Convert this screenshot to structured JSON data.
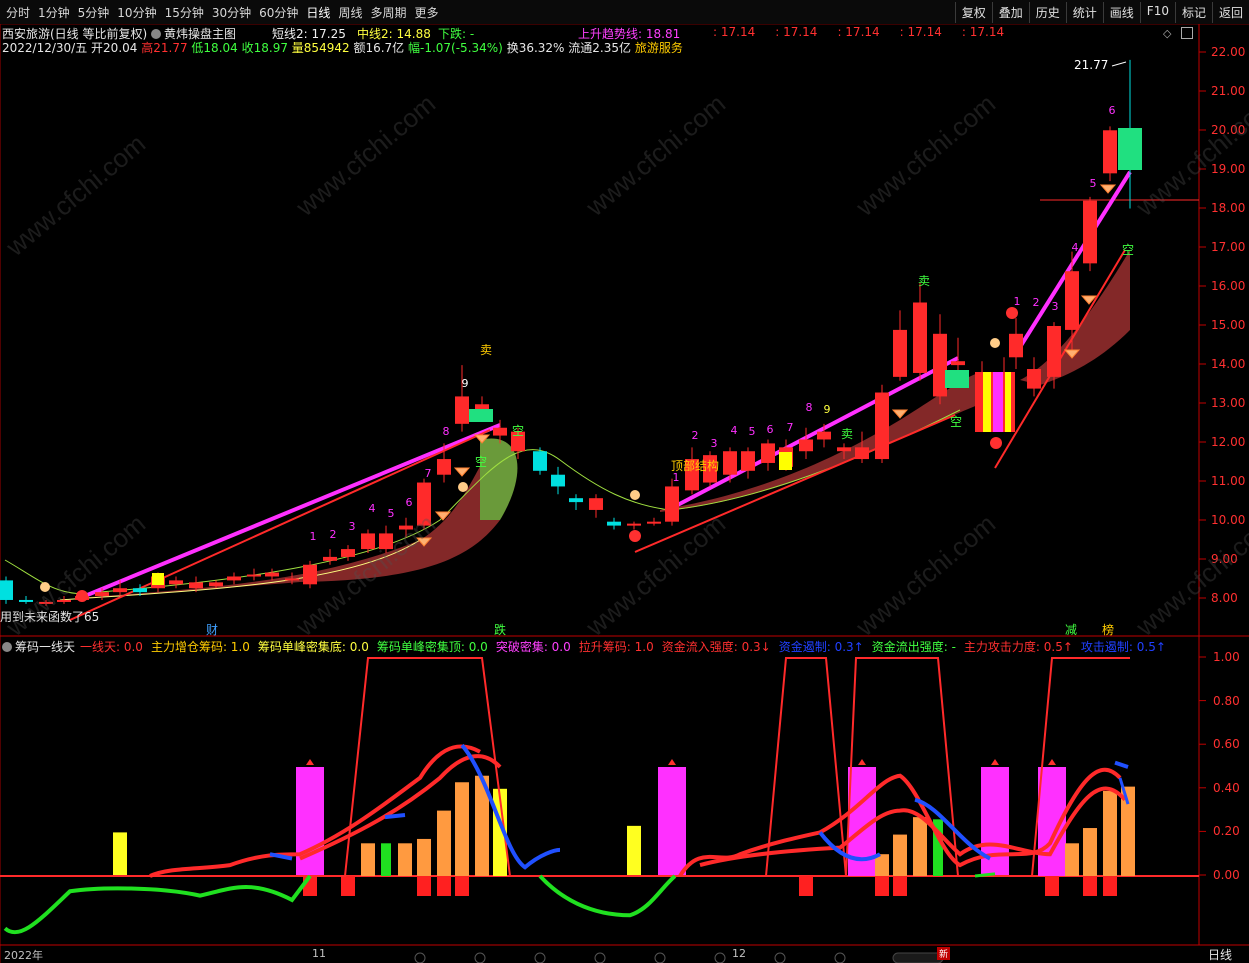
{
  "toolbar": {
    "periods": [
      "分时",
      "1分钟",
      "5分钟",
      "10分钟",
      "15分钟",
      "30分钟",
      "60分钟",
      "日线",
      "周线",
      "多周期",
      "更多"
    ],
    "active": "日线",
    "right_buttons": [
      "复权",
      "叠加",
      "历史",
      "统计",
      "画线",
      "F10",
      "标记",
      "返回"
    ]
  },
  "header": {
    "stock": "西安旅游(日线 等比前复权)",
    "formula": "黄炜操盘主图",
    "short_line": "短线2: 17.25",
    "mid_line": "中线2: 14.88",
    "down": "下跌: -",
    "up_trend": "上升趋势线: 18.81",
    "repeats": [
      ": 17.14",
      ": 17.14",
      ": 17.14",
      ": 17.14",
      ": 17.14"
    ],
    "date": "2022/12/30/五",
    "open": "开20.04",
    "high": "高21.77",
    "low": "低18.04",
    "close": "收18.97",
    "volume": "量854942",
    "amount": "额16.7亿",
    "change": "幅-1.07(-5.34%)",
    "turnover": "换36.32%",
    "float": "流通2.35亿",
    "sector": "旅游服务",
    "peak_label": "21.77",
    "bottom_note": "用到未来函数了65"
  },
  "main_axis": [
    "22.00",
    "21.00",
    "20.00",
    "19.00",
    "18.00",
    "17.00",
    "16.00",
    "15.00",
    "14.00",
    "13.00",
    "12.00",
    "11.00",
    "10.00",
    "9.00",
    "8.00"
  ],
  "sub_axis": [
    "1.00",
    "0.80",
    "0.60",
    "0.40",
    "0.20",
    "0.00"
  ],
  "annotations": {
    "cai": "财",
    "die": "跌",
    "jian": "减",
    "bang": "榜",
    "sell": "卖",
    "empty": "空",
    "top_structure": "顶部结构"
  },
  "sub_header": {
    "name": "筹码一线天",
    "items": [
      {
        "text": "一线天: 0.0",
        "color": "#ff3030"
      },
      {
        "text": "主力增仓筹码: 1.0",
        "color": "#ffcc00"
      },
      {
        "text": "筹码单峰密集底: 0.0",
        "color": "#ffff40"
      },
      {
        "text": "筹码单峰密集顶: 0.0",
        "color": "#40ff40"
      },
      {
        "text": "突破密集: 0.0",
        "color": "#ff40ff"
      },
      {
        "text": "拉升筹码: 1.0",
        "color": "#ff3030"
      },
      {
        "text": "资金流入强度: 0.3↓",
        "color": "#ff3030"
      },
      {
        "text": "资金遏制: 0.3↑",
        "color": "#2040ff"
      },
      {
        "text": "资金流出强度: -",
        "color": "#40ff40"
      },
      {
        "text": "主力攻击力度: 0.5↑",
        "color": "#ff3030"
      },
      {
        "text": "攻击遏制: 0.5↑",
        "color": "#2040ff"
      }
    ]
  },
  "bottom_axis": {
    "year": "2022年",
    "m11": "11",
    "m12": "12",
    "tag": "新",
    "right": "日线"
  },
  "colors": {
    "up": "#ff2a2a",
    "down": "#00e0e0",
    "axis": "#c00000",
    "magenta": "#ff20ff"
  }
}
